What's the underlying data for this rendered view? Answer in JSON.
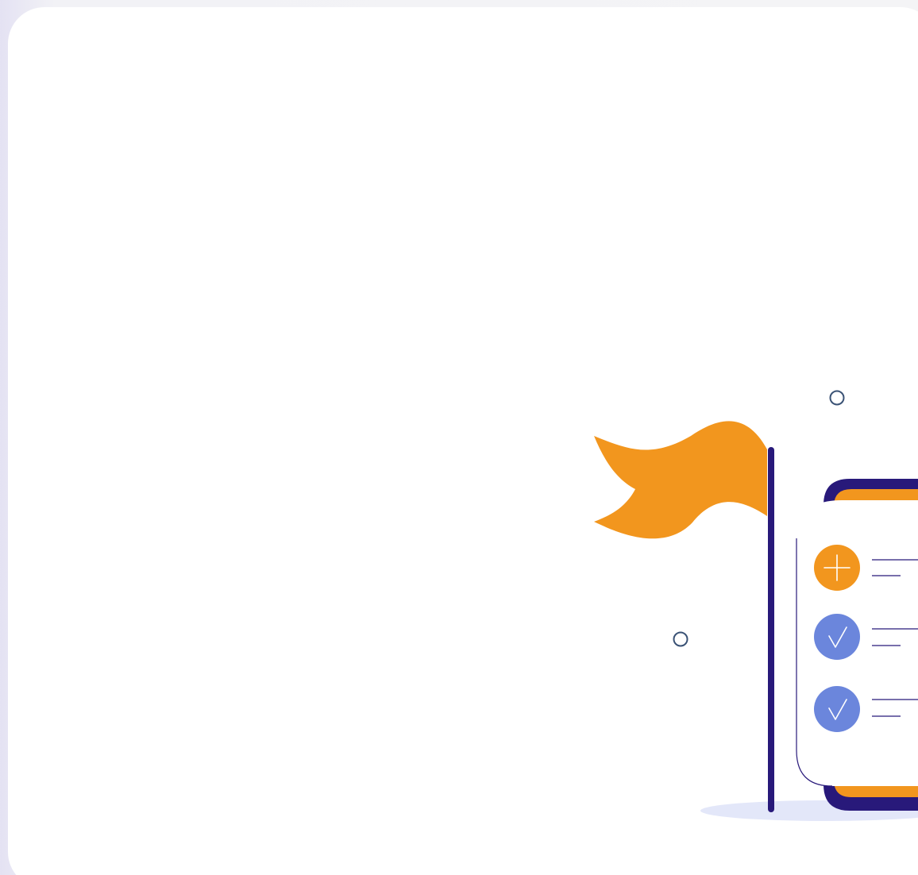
{
  "colors": {
    "page_background": "#f2f2f6",
    "card_background": "#ffffff",
    "flag": "#f2961e",
    "pole": "#28197a",
    "device_frame": "#28197a",
    "device_accent": "#f2961e",
    "add_badge": "#f2961e",
    "done_badge": "#6b86dc",
    "shadow": "#e3e7f9",
    "decor_circle_stroke": "#3a5275"
  },
  "checklist": {
    "items": [
      {
        "icon": "plus-icon",
        "state": "add"
      },
      {
        "icon": "checkmark-icon",
        "state": "done"
      },
      {
        "icon": "checkmark-icon",
        "state": "done"
      }
    ]
  }
}
